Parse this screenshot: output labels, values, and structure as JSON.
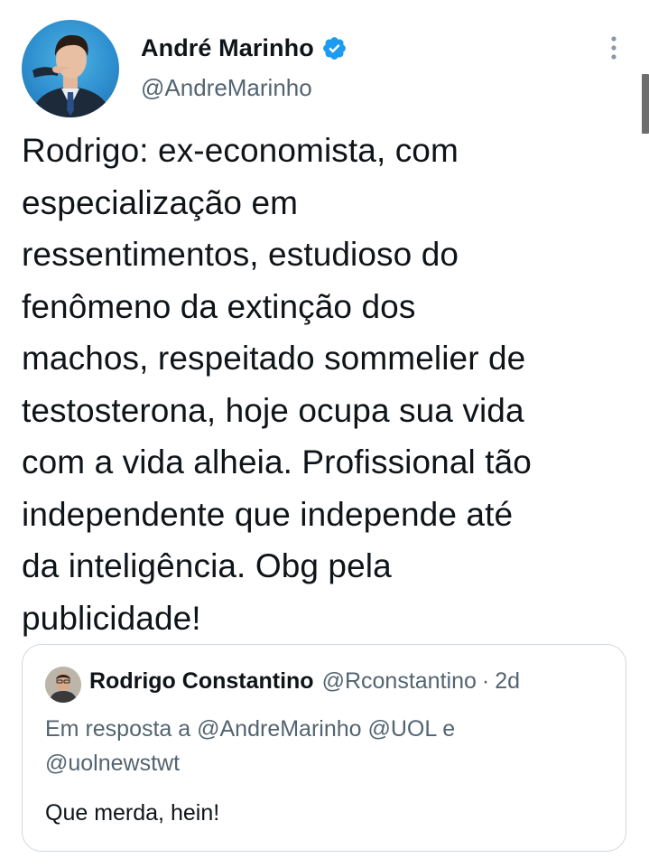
{
  "tweet": {
    "author": {
      "display_name": "André Marinho",
      "handle": "@AndreMarinho",
      "verified": true,
      "avatar_icon": "profile-photo-man-in-suit"
    },
    "text": "Rodrigo: ex-economista, com\nespecialização em\nressentimentos, estudioso do\nfenômeno da extinção dos\nmachos, respeitado sommelier de\ntestosterona, hoje ocupa sua vida\ncom a vida alheia. Profissional tão\nindependente que independe até\nda inteligência. Obg pela\npublicidade!",
    "menu_icon": "more-vertical-icon"
  },
  "quoted_tweet": {
    "display_name": "Rodrigo Constantino",
    "handle": "@Rconstantino",
    "separator": "·",
    "time": "2d",
    "reply_context": "Em resposta a @AndreMarinho @UOL e @uolnewstwt",
    "text": "Que merda, hein!"
  },
  "colors": {
    "primary_text": "#0f1419",
    "secondary_text": "#536471",
    "verified_blue": "#1d9bf0",
    "border": "#cfd9de"
  }
}
